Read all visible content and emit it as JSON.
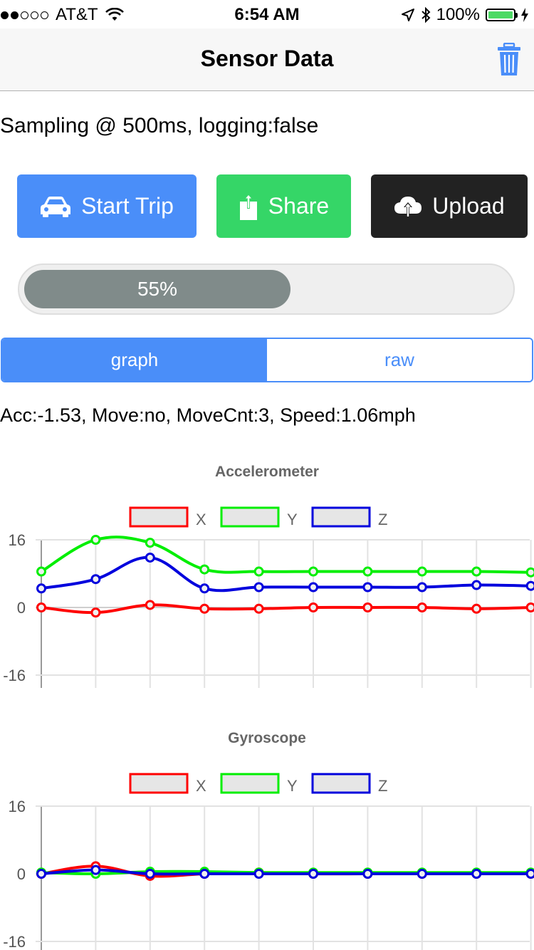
{
  "status_bar": {
    "carrier": "AT&T",
    "time": "6:54 AM",
    "battery": "100%",
    "signal_bars_filled": 2,
    "signal_bars_total": 5
  },
  "nav": {
    "title": "Sensor Data"
  },
  "sampling_text": "Sampling @ 500ms, logging:false",
  "buttons": {
    "start_trip": "Start Trip",
    "share": "Share",
    "upload": "Upload"
  },
  "progress": {
    "label": "55%",
    "fraction": 0.55
  },
  "tabs": {
    "graph": "graph",
    "raw": "raw",
    "selected": "graph"
  },
  "readout": "Acc:-1.53, Move:no, MoveCnt:3, Speed:1.06mph",
  "colors": {
    "accent": "#4a8ef9",
    "share": "#35d667",
    "upload": "#222222",
    "progress": "#808b8a",
    "x": "#ff0000",
    "y": "#00ee00",
    "z": "#0000dd"
  },
  "chart_data": [
    {
      "type": "line",
      "title": "Accelerometer",
      "ylim": [
        -16,
        16
      ],
      "yticks": [
        "16",
        "0",
        "-16"
      ],
      "grid": true,
      "legend": "top-center",
      "x": [
        1,
        2,
        3,
        4,
        5,
        6,
        7,
        8,
        9,
        10
      ],
      "series": [
        {
          "name": "X",
          "color": "#ff0000",
          "values": [
            0.0,
            -1.2,
            0.6,
            -0.3,
            -0.3,
            0.0,
            0.0,
            0.0,
            -0.3,
            0.0
          ]
        },
        {
          "name": "Y",
          "color": "#00ee00",
          "values": [
            8.5,
            16.0,
            15.3,
            9.0,
            8.5,
            8.5,
            8.5,
            8.5,
            8.5,
            8.3
          ]
        },
        {
          "name": "Z",
          "color": "#0000dd",
          "values": [
            4.5,
            6.7,
            11.8,
            4.5,
            4.8,
            4.8,
            4.8,
            4.8,
            5.3,
            5.1
          ]
        }
      ]
    },
    {
      "type": "line",
      "title": "Gyroscope",
      "ylim": [
        -16,
        16
      ],
      "yticks": [
        "16",
        "0",
        "-16"
      ],
      "grid": true,
      "legend": "top-center",
      "x": [
        1,
        2,
        3,
        4,
        5,
        6,
        7,
        8,
        9,
        10
      ],
      "series": [
        {
          "name": "X",
          "color": "#ff0000",
          "values": [
            0.0,
            1.8,
            -0.5,
            0.0,
            0.3,
            0.0,
            0.0,
            0.0,
            0.0,
            0.0
          ]
        },
        {
          "name": "Y",
          "color": "#00ee00",
          "values": [
            0.3,
            0.0,
            0.5,
            0.5,
            0.3,
            0.3,
            0.3,
            0.3,
            0.3,
            0.3
          ]
        },
        {
          "name": "Z",
          "color": "#0000dd",
          "values": [
            0.0,
            0.9,
            0.0,
            0.0,
            0.0,
            0.0,
            0.0,
            0.0,
            0.0,
            0.0
          ]
        }
      ]
    }
  ]
}
